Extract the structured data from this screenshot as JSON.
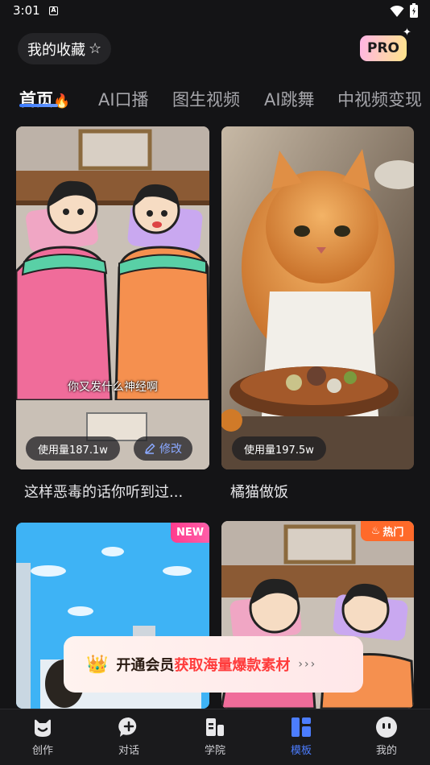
{
  "status": {
    "time": "3:01",
    "a_icon": "A"
  },
  "header": {
    "favorites_label": "我的收藏",
    "pro_label": "PRO"
  },
  "tabs": [
    {
      "label": "首页",
      "active": true
    },
    {
      "label": "AI口播",
      "active": false
    },
    {
      "label": "图生视频",
      "active": false
    },
    {
      "label": "AI跳舞",
      "active": false
    },
    {
      "label": "中视频变现",
      "active": false
    }
  ],
  "cards": [
    {
      "title": "这样恶毒的话你听到过...",
      "usage": "使用量187.1w",
      "edit_label": "修改",
      "subtitle": "你又发什么神经啊"
    },
    {
      "title": "橘猫做饭",
      "usage": "使用量197.5w"
    },
    {
      "badge": "NEW"
    },
    {
      "badge": "热门"
    }
  ],
  "banner": {
    "text_a": "开通会员",
    "text_b": "获取海量爆款素材"
  },
  "nav": [
    {
      "label": "创作",
      "icon": "smile-bag-icon",
      "active": false
    },
    {
      "label": "对话",
      "icon": "chat-plus-icon",
      "active": false
    },
    {
      "label": "学院",
      "icon": "book-icon",
      "active": false
    },
    {
      "label": "模板",
      "icon": "template-grid-icon",
      "active": true
    },
    {
      "label": "我的",
      "icon": "face-icon",
      "active": false
    }
  ],
  "colors": {
    "accent": "#4c7dff",
    "new_badge": "#ff3c8d",
    "hot_badge": "#ff6a2a",
    "highlight_text": "#ff3c3c"
  }
}
